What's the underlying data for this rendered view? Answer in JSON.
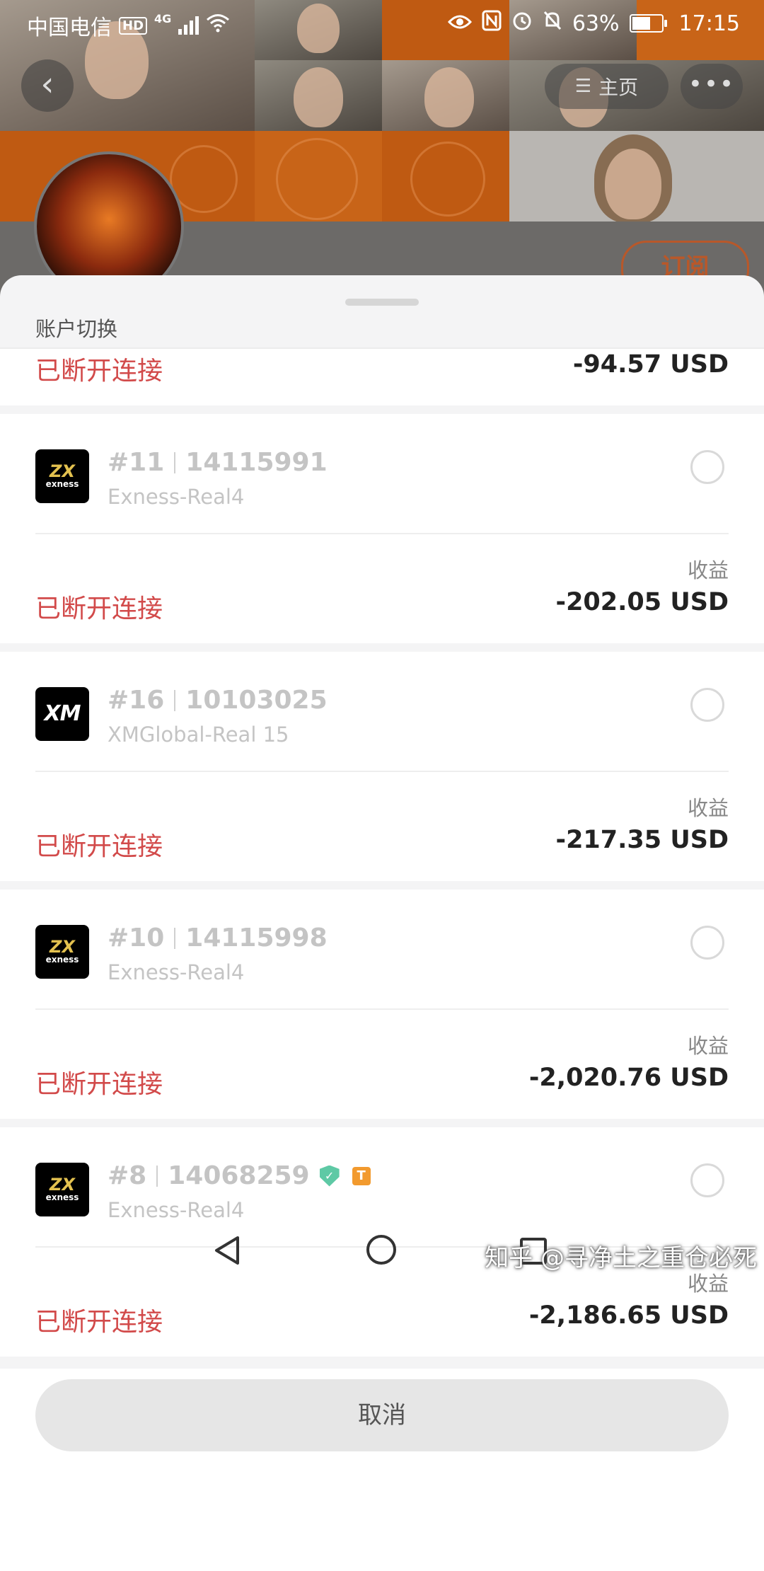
{
  "status_bar": {
    "carrier": "中国电信",
    "hd": "HD",
    "network": "4G",
    "battery": "63%",
    "battery_level": 0.63,
    "time": "17:15"
  },
  "header": {
    "home_label": "主页",
    "more_label": "•••",
    "subscribe_label": "订阅"
  },
  "sheet": {
    "title": "账户切换",
    "income_label": "收益",
    "partial_account": {
      "status": "已断开连接",
      "income": "-94.57 USD"
    },
    "accounts": [
      {
        "index": "#11",
        "number": "14115991",
        "server": "Exness-Real4",
        "broker": "exness",
        "logo_mark": "ZX",
        "logo_name": "exness",
        "status": "已断开连接",
        "income": "-202.05 USD",
        "verified": false,
        "tag": ""
      },
      {
        "index": "#16",
        "number": "10103025",
        "server": "XMGlobal-Real 15",
        "broker": "xm",
        "logo_mark": "XM",
        "logo_name": "",
        "status": "已断开连接",
        "income": "-217.35 USD",
        "verified": false,
        "tag": ""
      },
      {
        "index": "#10",
        "number": "14115998",
        "server": "Exness-Real4",
        "broker": "exness",
        "logo_mark": "ZX",
        "logo_name": "exness",
        "status": "已断开连接",
        "income": "-2,020.76 USD",
        "verified": false,
        "tag": ""
      },
      {
        "index": "#8",
        "number": "14068259",
        "server": "Exness-Real4",
        "broker": "exness",
        "logo_mark": "ZX",
        "logo_name": "exness",
        "status": "已断开连接",
        "income": "-2,186.65 USD",
        "verified": true,
        "tag": "T"
      }
    ],
    "cancel_label": "取消"
  },
  "watermark": "知乎 @寻净土之重仓必死",
  "colors": {
    "disconnected": "#d24a4a",
    "verified": "#5ec9a5",
    "tag": "#f29a2e",
    "brand_orange": "#b8582a"
  }
}
